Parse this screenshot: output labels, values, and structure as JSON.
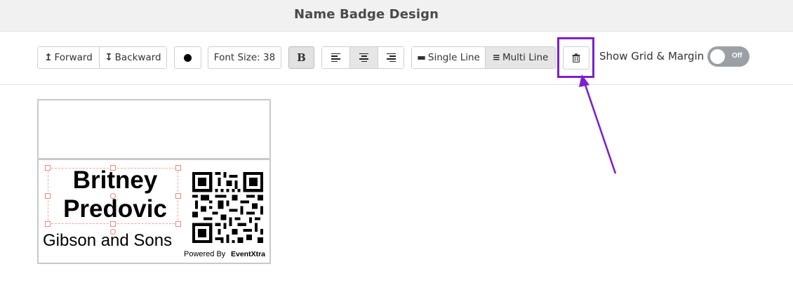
{
  "header": {
    "title": "Name Badge Design"
  },
  "toolbar": {
    "forward_label": "Forward",
    "backward_label": "Backward",
    "font_size_label": "Font Size: 38",
    "bold_label": "B",
    "single_line_label": "Single Line",
    "multi_line_label": "Multi Line",
    "grid_label": "Show Grid & Margin",
    "toggle_state": "Off"
  },
  "badge": {
    "first_name": "Britney",
    "last_name": "Predovic",
    "company": "Gibson and Sons",
    "powered_by": "Powered By",
    "brand": "EventXtra"
  },
  "colors": {
    "highlight": "#7e1fd1",
    "toggle_off": "#9aa0a6",
    "handles": "#e8897c"
  }
}
